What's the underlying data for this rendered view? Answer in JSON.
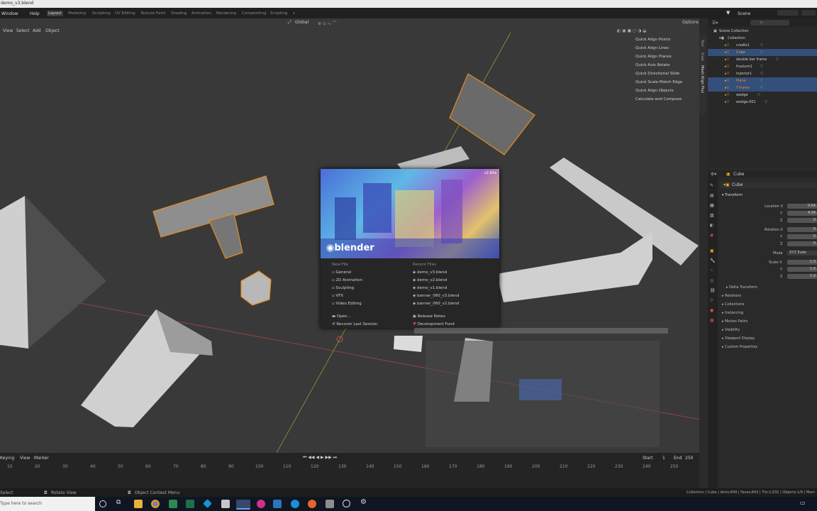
{
  "window": {
    "title": "demo_v3.blend"
  },
  "topmenu": {
    "items": [
      "Window",
      "Help"
    ]
  },
  "workspaces": {
    "tabs": [
      "Layout",
      "Modeling",
      "Sculpting",
      "UV Editing",
      "Texture Paint",
      "Shading",
      "Animation",
      "Rendering",
      "Compositing",
      "Scripting"
    ],
    "active": "Layout"
  },
  "scene": {
    "label": "Scene"
  },
  "viewport_header": {
    "menus": [
      "View",
      "Select",
      "Add",
      "Object"
    ],
    "transform_orientation": "Global",
    "options_label": "Options"
  },
  "npanel": {
    "items": [
      "Quick Align Points",
      "Quick Align Lines",
      "Quick Align Planes",
      "Quick Axis Rotate",
      "Quick Directional Slide",
      "Quick Scale Match Edge",
      "Quick Align Objects",
      "Calculate and Compose"
    ],
    "tabs": [
      "Tool",
      "View",
      "Mesh Align Plus"
    ]
  },
  "splash": {
    "version": "v2.82a",
    "logo": "blender",
    "new_file_header": "New File",
    "new_file_items": [
      "General",
      "2D Animation",
      "Sculpting",
      "VFX",
      "Video Editing"
    ],
    "recent_header": "Recent Files",
    "recent_items": [
      "demo_v3.blend",
      "demo_v2.blend",
      "demo_v1.blend",
      "banner_060_v3.blend",
      "banner_060_v2.blend"
    ],
    "bottom_left": [
      "Open...",
      "Recover Last Session"
    ],
    "bottom_right": [
      "Release Notes",
      "Development Fund"
    ]
  },
  "outliner": {
    "root": "Scene Collection",
    "collection": "Collection",
    "rows": [
      {
        "name": "cradle1",
        "selected": false
      },
      {
        "name": "Cube",
        "selected": true
      },
      {
        "name": "double bar frame",
        "selected": false
      },
      {
        "name": "frustum1",
        "selected": false
      },
      {
        "name": "injector1",
        "selected": false
      },
      {
        "name": "Plane",
        "selected": true
      },
      {
        "name": "T-frame",
        "selected": true
      },
      {
        "name": "wedge",
        "selected": false
      },
      {
        "name": "wedge.001",
        "selected": false
      }
    ]
  },
  "properties": {
    "object_name": "Cube",
    "data_name": "Cube",
    "transform_header": "Transform",
    "location_label": "Location X",
    "location_values": [
      "0.64",
      "4.58",
      "0"
    ],
    "rotation_label": "Rotation X",
    "rotation_values": [
      "0",
      "0",
      "0"
    ],
    "mode_label": "Mode",
    "mode_value": "XYZ Euler",
    "scale_label": "Scale X",
    "scale_values": [
      "1.0",
      "1.0",
      "1.0"
    ],
    "axis_y": "Y",
    "axis_z": "Z",
    "sections": [
      "Delta Transform",
      "Relations",
      "Collections",
      "Instancing",
      "Motion Paths",
      "Visibility",
      "Viewport Display",
      "Custom Properties"
    ]
  },
  "timeline": {
    "menus": [
      "Keying",
      "View",
      "Marker"
    ],
    "ticks": [
      "10",
      "20",
      "30",
      "40",
      "50",
      "60",
      "70",
      "80",
      "90",
      "100",
      "110",
      "120",
      "130",
      "140",
      "150",
      "160",
      "170",
      "180",
      "190",
      "200",
      "210",
      "220",
      "230",
      "240",
      "250"
    ],
    "start_label": "Start",
    "start_value": "1",
    "end_label": "End",
    "end_value": "250"
  },
  "statusbar": {
    "select": "Select",
    "rotate": "Rotate View",
    "context": "Object Context Menu",
    "stats": "Collection | Cube | Verts:849 | Faces:843 | Tris:1,632 | Objects:1/9 | Mem"
  },
  "taskbar": {
    "search_placeholder": "Type here to search"
  },
  "colors": {
    "accent": "#f5a623",
    "selection": "#334f7a",
    "header": "#202020"
  }
}
